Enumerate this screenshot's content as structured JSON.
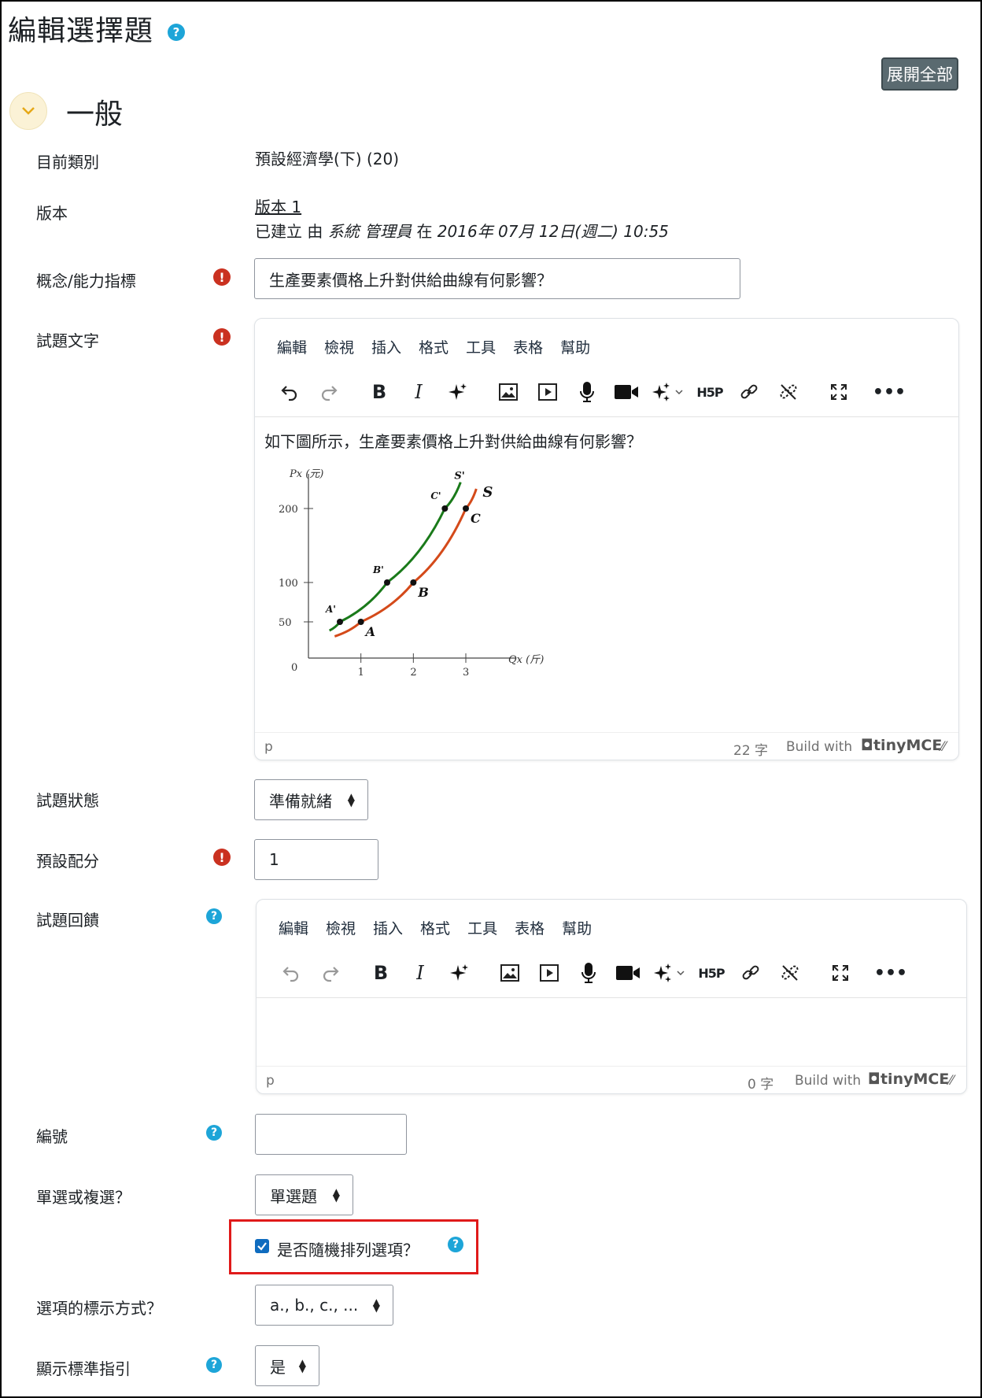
{
  "page": {
    "title": "編輯選擇題",
    "expand_all": "展開全部"
  },
  "section": {
    "title": "一般"
  },
  "fields": {
    "category": {
      "label": "目前類別",
      "value": "預設經濟學(下) (20)"
    },
    "version": {
      "label": "版本",
      "link": "版本 1",
      "created_prefix": "已建立 由",
      "creator": "系統 管理員",
      "created_mid": "在",
      "created_date": "2016年 07月 12日(週二) 10:55"
    },
    "concept": {
      "label": "概念/能力指標",
      "value": "生產要素價格上升對供給曲線有何影響？"
    },
    "question_text": {
      "label": "試題文字",
      "content": "如下圖所示，生產要素價格上升對供給曲線有何影響？",
      "path": "p",
      "word_count": "22 字",
      "build_with": "Build with",
      "brand": "tinyMCE"
    },
    "status": {
      "label": "試題狀態",
      "value": "準備就緒"
    },
    "default_mark": {
      "label": "預設配分",
      "value": "1"
    },
    "feedback": {
      "label": "試題回饋",
      "path": "p",
      "word_count": "0 字",
      "build_with": "Build with",
      "brand": "tinyMCE"
    },
    "id_number": {
      "label": "編號",
      "value": ""
    },
    "single": {
      "label": "單選或複選？",
      "value": "單選題"
    },
    "shuffle": {
      "label": "是否隨機排列選項？",
      "checked": true
    },
    "numbering": {
      "label": "選項的標示方式？",
      "value": "a., b., c., ..."
    },
    "show_instructions": {
      "label": "顯示標準指引",
      "value": "是"
    }
  },
  "editor_menu": [
    "編輯",
    "檢視",
    "插入",
    "格式",
    "工具",
    "表格",
    "幫助"
  ],
  "toolbar_icons": [
    "undo-icon",
    "redo-icon",
    "bold-icon",
    "italic-icon",
    "ai-sparkle-icon",
    "image-icon",
    "media-icon",
    "microphone-icon",
    "video-icon",
    "ai-magic-icon",
    "h5p-icon",
    "link-icon",
    "unlink-icon",
    "fullscreen-icon",
    "more-icon"
  ],
  "colors": {
    "help": "#1da5d8",
    "error": "#ca3120",
    "curve_s_prime": "#1a7a1a",
    "curve_s": "#d44a1a",
    "highlight": "#e01a1a",
    "checkbox": "#0f6cbf"
  },
  "chart_data": {
    "type": "line",
    "ylabel": "Px (元)",
    "xlabel": "Qx (斤)",
    "x_ticks": [
      "1",
      "2",
      "3"
    ],
    "y_ticks": [
      "50",
      "100",
      "200"
    ],
    "origin_label": "0",
    "series": [
      {
        "name": "S'",
        "points": [
          {
            "x": 0.4,
            "y": 38
          },
          {
            "x": 0.6,
            "y": 50
          },
          {
            "x": 1.5,
            "y": 100
          },
          {
            "x": 2.6,
            "y": 200
          },
          {
            "x": 2.9,
            "y": 240
          }
        ],
        "labels": [
          {
            "text": "A'",
            "x": 0.6,
            "y": 50
          },
          {
            "text": "B'",
            "x": 1.5,
            "y": 100
          },
          {
            "text": "C'",
            "x": 2.6,
            "y": 200
          }
        ]
      },
      {
        "name": "S",
        "points": [
          {
            "x": 0.5,
            "y": 30
          },
          {
            "x": 1.0,
            "y": 50
          },
          {
            "x": 2.0,
            "y": 100
          },
          {
            "x": 3.0,
            "y": 200
          },
          {
            "x": 3.2,
            "y": 230
          }
        ],
        "labels": [
          {
            "text": "A",
            "x": 1.0,
            "y": 50
          },
          {
            "text": "B",
            "x": 2.0,
            "y": 100
          },
          {
            "text": "C",
            "x": 3.0,
            "y": 200
          }
        ]
      }
    ],
    "ylim": [
      0,
      260
    ],
    "xlim": [
      0,
      3.6
    ]
  }
}
